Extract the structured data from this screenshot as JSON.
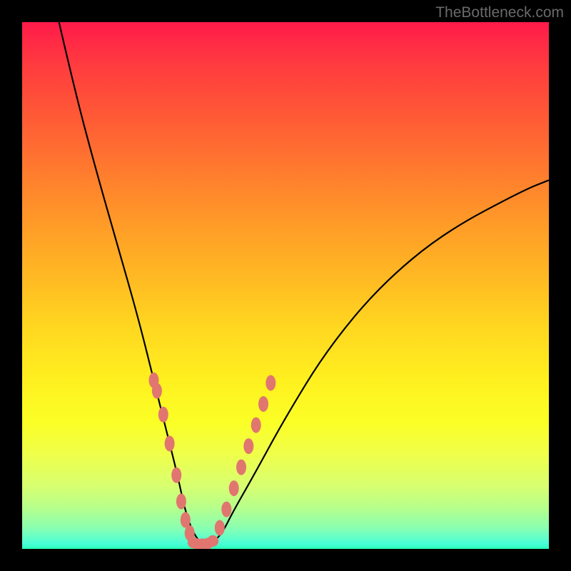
{
  "watermark": "TheBottleneck.com",
  "chart_data": {
    "type": "line",
    "title": "",
    "xlabel": "",
    "ylabel": "",
    "xlim": [
      0,
      100
    ],
    "ylim": [
      0,
      100
    ],
    "background_gradient": {
      "top": "#ff1a4a",
      "bottom": "#2affb8",
      "meaning": "red=high bottleneck, green=low bottleneck"
    },
    "series": [
      {
        "name": "bottleneck-curve",
        "color": "#000000",
        "x": [
          7,
          10,
          14,
          18,
          22,
          25,
          27.5,
          29.5,
          31,
          32.5,
          34,
          36,
          38,
          40,
          44,
          50,
          58,
          68,
          80,
          95,
          100
        ],
        "y": [
          100,
          87,
          72,
          58,
          44,
          32,
          22,
          14,
          7,
          3,
          1,
          1,
          3,
          7,
          14,
          25,
          38,
          50,
          60,
          68,
          70
        ]
      },
      {
        "name": "datapoints-left-branch",
        "color": "#e0766f",
        "type": "scatter",
        "x": [
          25.0,
          25.6,
          26.8,
          28.0,
          29.3,
          30.2,
          31.0,
          31.8
        ],
        "y": [
          32.0,
          30.0,
          25.5,
          20.0,
          14.0,
          9.0,
          5.5,
          3.0
        ]
      },
      {
        "name": "datapoints-bottom",
        "color": "#e0766f",
        "type": "scatter",
        "x": [
          32.5,
          33.3,
          34.2,
          35.2,
          36.2
        ],
        "y": [
          1.2,
          0.9,
          0.9,
          1.0,
          1.5
        ]
      },
      {
        "name": "datapoints-right-branch",
        "color": "#e0766f",
        "type": "scatter",
        "x": [
          37.5,
          38.8,
          40.2,
          41.6,
          43.0,
          44.4,
          45.8,
          47.2
        ],
        "y": [
          4.0,
          7.5,
          11.5,
          15.5,
          19.5,
          23.5,
          27.5,
          31.5
        ]
      }
    ]
  }
}
